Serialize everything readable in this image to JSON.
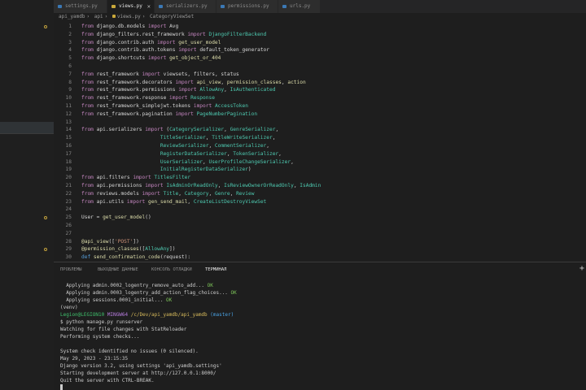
{
  "tabs": [
    {
      "label": "settings.py",
      "active": false
    },
    {
      "label": "views.py",
      "active": true
    },
    {
      "label": "serializers.py",
      "active": false
    },
    {
      "label": "permissions.py",
      "active": false
    },
    {
      "label": "urls.py",
      "active": false
    }
  ],
  "breadcrumb": [
    "api_yamdb",
    "api",
    "views.py",
    "CategoryViewSet"
  ],
  "code": [
    {
      "n": "1",
      "parts": [
        [
          "kw",
          "from "
        ],
        [
          "t",
          "django.db.models "
        ],
        [
          "kw",
          "import "
        ],
        [
          "t",
          "Avg"
        ]
      ]
    },
    {
      "n": "2",
      "parts": [
        [
          "kw",
          "from "
        ],
        [
          "t",
          "django_filters.rest_framework "
        ],
        [
          "kw",
          "import "
        ],
        [
          "mod",
          "DjangoFilterBackend"
        ]
      ]
    },
    {
      "n": "3",
      "parts": [
        [
          "kw",
          "from "
        ],
        [
          "t",
          "django.contrib.auth "
        ],
        [
          "kw",
          "import "
        ],
        [
          "fn",
          "get_user_model"
        ]
      ]
    },
    {
      "n": "4",
      "parts": [
        [
          "kw",
          "from "
        ],
        [
          "t",
          "django.contrib.auth.tokens "
        ],
        [
          "kw",
          "import "
        ],
        [
          "t",
          "default_token_generator"
        ]
      ]
    },
    {
      "n": "5",
      "parts": [
        [
          "kw",
          "from "
        ],
        [
          "t",
          "django.shortcuts "
        ],
        [
          "kw",
          "import "
        ],
        [
          "fn",
          "get_object_or_404"
        ]
      ]
    },
    {
      "n": "6",
      "parts": []
    },
    {
      "n": "7",
      "parts": [
        [
          "kw",
          "from "
        ],
        [
          "t",
          "rest_framework "
        ],
        [
          "kw",
          "import "
        ],
        [
          "t",
          "viewsets, filters, status"
        ]
      ]
    },
    {
      "n": "8",
      "parts": [
        [
          "kw",
          "from "
        ],
        [
          "t",
          "rest_framework.decorators "
        ],
        [
          "kw",
          "import "
        ],
        [
          "fn",
          "api_view"
        ],
        [
          "t",
          ", "
        ],
        [
          "fn",
          "permission_classes"
        ],
        [
          "t",
          ", "
        ],
        [
          "fn",
          "action"
        ]
      ]
    },
    {
      "n": "9",
      "parts": [
        [
          "kw",
          "from "
        ],
        [
          "t",
          "rest_framework.permissions "
        ],
        [
          "kw",
          "import "
        ],
        [
          "mod",
          "AllowAny"
        ],
        [
          "t",
          ", "
        ],
        [
          "mod",
          "IsAuthenticated"
        ]
      ]
    },
    {
      "n": "10",
      "parts": [
        [
          "kw",
          "from "
        ],
        [
          "t",
          "rest_framework.response "
        ],
        [
          "kw",
          "import "
        ],
        [
          "mod",
          "Response"
        ]
      ]
    },
    {
      "n": "11",
      "parts": [
        [
          "kw",
          "from "
        ],
        [
          "t",
          "rest_framework_simplejwt.tokens "
        ],
        [
          "kw",
          "import "
        ],
        [
          "mod",
          "AccessToken"
        ]
      ]
    },
    {
      "n": "12",
      "parts": [
        [
          "kw",
          "from "
        ],
        [
          "t",
          "rest_framework.pagination "
        ],
        [
          "kw",
          "import "
        ],
        [
          "mod",
          "PageNumberPagination"
        ]
      ]
    },
    {
      "n": "13",
      "parts": []
    },
    {
      "n": "14",
      "parts": [
        [
          "kw",
          "from "
        ],
        [
          "t",
          "api.serializers "
        ],
        [
          "kw",
          "import "
        ],
        [
          "t",
          "("
        ],
        [
          "mod",
          "CategorySerializer"
        ],
        [
          "t",
          ", "
        ],
        [
          "mod",
          "GenreSerializer"
        ],
        [
          "t",
          ","
        ]
      ]
    },
    {
      "n": "15",
      "parts": [
        [
          "t",
          "                          "
        ],
        [
          "mod",
          "TitleSerializer"
        ],
        [
          "t",
          ", "
        ],
        [
          "mod",
          "TitleWriteSerializer"
        ],
        [
          "t",
          ","
        ]
      ]
    },
    {
      "n": "16",
      "parts": [
        [
          "t",
          "                          "
        ],
        [
          "mod",
          "ReviewSerializer"
        ],
        [
          "t",
          ", "
        ],
        [
          "mod",
          "CommentSerializer"
        ],
        [
          "t",
          ","
        ]
      ]
    },
    {
      "n": "17",
      "parts": [
        [
          "t",
          "                          "
        ],
        [
          "mod",
          "RegisterDataSerializer"
        ],
        [
          "t",
          ", "
        ],
        [
          "mod",
          "TokenSerializer"
        ],
        [
          "t",
          ","
        ]
      ]
    },
    {
      "n": "18",
      "parts": [
        [
          "t",
          "                          "
        ],
        [
          "mod",
          "UserSerializer"
        ],
        [
          "t",
          ", "
        ],
        [
          "mod",
          "UserProfileChangeSerializer"
        ],
        [
          "t",
          ","
        ]
      ]
    },
    {
      "n": "19",
      "parts": [
        [
          "t",
          "                          "
        ],
        [
          "mod",
          "InitialRegisterDataSerializer"
        ],
        [
          "t",
          ")"
        ]
      ]
    },
    {
      "n": "20",
      "parts": [
        [
          "kw",
          "from "
        ],
        [
          "t",
          "api.filters "
        ],
        [
          "kw",
          "import "
        ],
        [
          "mod",
          "TitlesFilter"
        ]
      ]
    },
    {
      "n": "21",
      "parts": [
        [
          "kw",
          "from "
        ],
        [
          "t",
          "api.permissions "
        ],
        [
          "kw",
          "import "
        ],
        [
          "mod",
          "IsAdminOrReadOnly"
        ],
        [
          "t",
          ", "
        ],
        [
          "mod",
          "IsReviewOwnerOrReadOnly"
        ],
        [
          "t",
          ", "
        ],
        [
          "mod",
          "IsAdmin"
        ]
      ]
    },
    {
      "n": "22",
      "parts": [
        [
          "kw",
          "from "
        ],
        [
          "t",
          "reviews.models "
        ],
        [
          "kw",
          "import "
        ],
        [
          "mod",
          "Title"
        ],
        [
          "t",
          ", "
        ],
        [
          "mod",
          "Category"
        ],
        [
          "t",
          ", "
        ],
        [
          "mod",
          "Genre"
        ],
        [
          "t",
          ", "
        ],
        [
          "mod",
          "Review"
        ]
      ]
    },
    {
      "n": "23",
      "parts": [
        [
          "kw",
          "from "
        ],
        [
          "t",
          "api.utils "
        ],
        [
          "kw",
          "import "
        ],
        [
          "fn",
          "gen_send_mail"
        ],
        [
          "t",
          ", "
        ],
        [
          "mod",
          "CreateListDestroyViewSet"
        ]
      ]
    },
    {
      "n": "24",
      "parts": []
    },
    {
      "n": "25",
      "parts": [
        [
          "t",
          "User = "
        ],
        [
          "fn",
          "get_user_model"
        ],
        [
          "t",
          "()"
        ]
      ]
    },
    {
      "n": "26",
      "parts": []
    },
    {
      "n": "27",
      "parts": []
    },
    {
      "n": "28",
      "parts": [
        [
          "dec",
          "@api_view"
        ],
        [
          "t",
          "(["
        ],
        [
          "str",
          "'POST'"
        ],
        [
          "t",
          "])"
        ]
      ]
    },
    {
      "n": "29",
      "parts": [
        [
          "dec",
          "@permission_classes"
        ],
        [
          "t",
          "(["
        ],
        [
          "mod",
          "AllowAny"
        ],
        [
          "t",
          "])"
        ]
      ]
    },
    {
      "n": "30",
      "parts": [
        [
          "def",
          "def "
        ],
        [
          "fn",
          "send_confirmation_code"
        ],
        [
          "t",
          "(request):"
        ]
      ]
    }
  ],
  "panel_tabs": [
    "ПРОБЛЕМЫ",
    "ВЫХОДНЫЕ ДАННЫЕ",
    "КОНСОЛЬ ОТЛАДКИ",
    "ТЕРМИНАЛ"
  ],
  "panel_plus": "+",
  "terminal": [
    [
      [
        "t",
        "  Applying admin.0002_logentry_remove_auto_add... "
      ],
      [
        "ok",
        "OK"
      ]
    ],
    [
      [
        "t",
        "  Applying admin.0003_logentry_add_action_flag_choices... "
      ],
      [
        "ok",
        "OK"
      ]
    ],
    [
      [
        "t",
        "  Applying sessions.0001_initial... "
      ],
      [
        "ok",
        "OK"
      ]
    ],
    [
      [
        "t",
        "(venv)"
      ]
    ],
    [
      [
        "usr",
        "Legion@LEGION10"
      ],
      [
        "t",
        " "
      ],
      [
        "host",
        "MINGW64"
      ],
      [
        "t",
        " "
      ],
      [
        "path",
        "/c/Dev/api_yamdb/api_yamdb"
      ],
      [
        "t",
        " "
      ],
      [
        "br",
        "(master)"
      ]
    ],
    [
      [
        "t",
        "$ python manage.py runserver"
      ]
    ],
    [
      [
        "t",
        "Watching for file changes with StatReloader"
      ]
    ],
    [
      [
        "t",
        "Performing system checks..."
      ]
    ],
    [
      [
        "t",
        ""
      ]
    ],
    [
      [
        "t",
        "System check identified no issues (0 silenced)."
      ]
    ],
    [
      [
        "t",
        "May 29, 2023 - 23:15:35"
      ]
    ],
    [
      [
        "t",
        "Django version 3.2, using settings 'api_yamdb.settings'"
      ]
    ],
    [
      [
        "t",
        "Starting development server at http://127.0.0.1:8000/"
      ]
    ],
    [
      [
        "t",
        "Quit the server with CTRL-BREAK."
      ]
    ]
  ]
}
